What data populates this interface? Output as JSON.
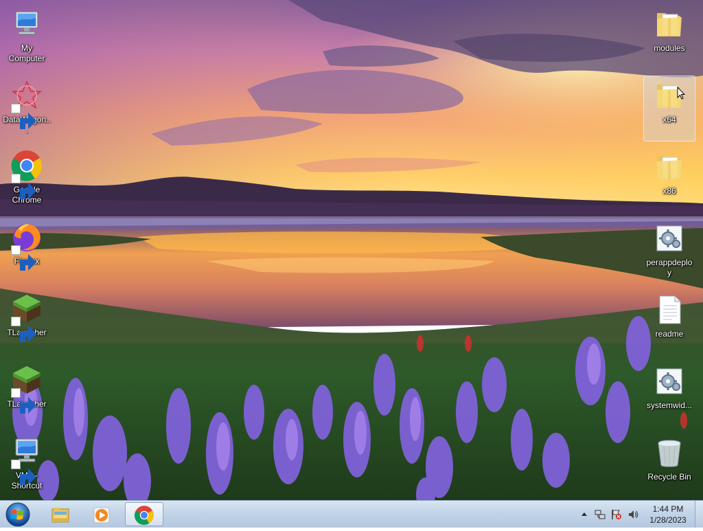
{
  "desktop": {
    "left_icons": [
      {
        "label": "My Computer",
        "icon": "computer-icon",
        "shortcut": false
      },
      {
        "label": "DataWagon...",
        "icon": "datawagon-icon",
        "shortcut": true
      },
      {
        "label": "Google Chrome",
        "icon": "chrome-icon",
        "shortcut": true
      },
      {
        "label": "Firefox",
        "icon": "firefox-icon",
        "shortcut": true
      },
      {
        "label": "TLauncher",
        "icon": "tlauncher-icon",
        "shortcut": true
      },
      {
        "label": "TLauncher",
        "icon": "tlauncher-icon",
        "shortcut": true
      },
      {
        "label": "VM5 - Shortcut",
        "icon": "computer-icon",
        "shortcut": true
      }
    ],
    "right_icons": [
      {
        "label": "modules",
        "icon": "folder-icon",
        "selected": false
      },
      {
        "label": "x64",
        "icon": "folder-icon",
        "selected": true
      },
      {
        "label": "x86",
        "icon": "folder-icon",
        "selected": false
      },
      {
        "label": "perappdeploy",
        "icon": "settings-file-icon",
        "selected": false
      },
      {
        "label": "readme",
        "icon": "text-file-icon",
        "selected": false
      },
      {
        "label": "systemwid...",
        "icon": "settings-file-icon",
        "selected": false
      },
      {
        "label": "Recycle Bin",
        "icon": "recycle-bin-icon",
        "selected": false
      }
    ]
  },
  "taskbar": {
    "start_icon": "windows-logo-icon",
    "pinned": [
      {
        "name": "file-explorer",
        "icon": "folder-library-icon",
        "active": false
      },
      {
        "name": "media-player",
        "icon": "media-player-icon",
        "active": false
      },
      {
        "name": "google-chrome",
        "icon": "chrome-icon",
        "active": true
      }
    ],
    "tray": {
      "icons": [
        "show-hidden-icons-icon",
        "network-icon",
        "action-center-flag-icon",
        "volume-icon"
      ],
      "time": "1:44 PM",
      "date": "1/28/2023"
    }
  },
  "colors": {
    "taskbar_top": "#d8e5f2",
    "taskbar_bottom": "#b4c8de",
    "sky_top": "#8a5fa8",
    "sky_horizon": "#ffd060",
    "flowers": "#7f62d8"
  }
}
